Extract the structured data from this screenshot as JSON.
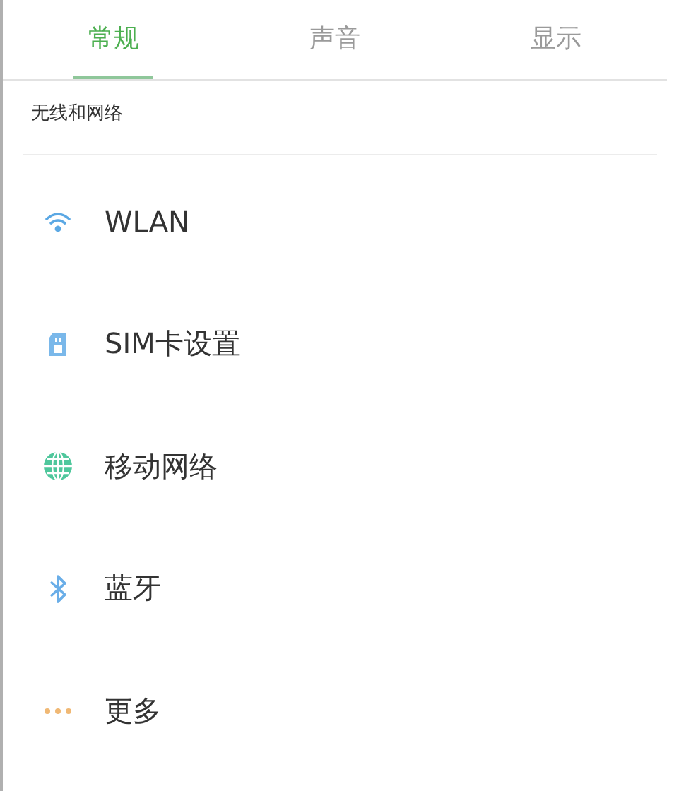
{
  "tabs": [
    {
      "label": "常规",
      "selected": true
    },
    {
      "label": "声音",
      "selected": false
    },
    {
      "label": "显示",
      "selected": false
    }
  ],
  "section": {
    "title": "无线和网络"
  },
  "items": [
    {
      "label": "WLAN"
    },
    {
      "label": "SIM卡设置"
    },
    {
      "label": "移动网络"
    },
    {
      "label": "蓝牙"
    },
    {
      "label": "更多"
    }
  ]
}
